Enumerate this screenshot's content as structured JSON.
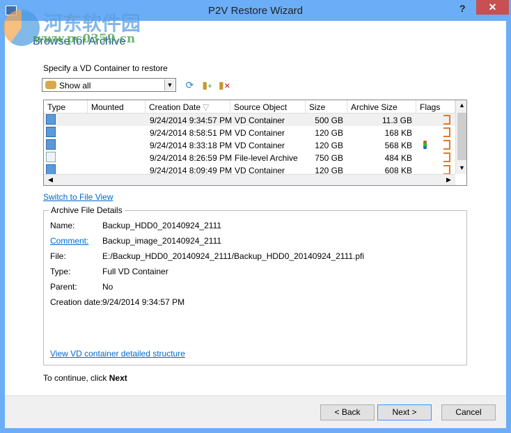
{
  "window": {
    "title": "P2V Restore Wizard",
    "help": "?",
    "close": "✕"
  },
  "watermark": {
    "cn": "河东软件园",
    "url": "www.pc0359.cn"
  },
  "heading": "Browse for Archive",
  "specify_label": "Specify a VD Container to restore",
  "filter": {
    "value": "Show all"
  },
  "toolbar": [
    "refresh-icon",
    "add-archive-icon",
    "remove-archive-icon"
  ],
  "table": {
    "columns": [
      "Type",
      "Mounted",
      "Creation Date",
      "Source Object",
      "Size",
      "Archive Size",
      "Flags"
    ],
    "sort_indicator": "▽",
    "rows": [
      {
        "type": "vd",
        "mounted": "",
        "date": "9/24/2014 9:34:57 PM",
        "source": "VD Container",
        "size": "500 GB",
        "archive_size": "11.3 GB",
        "selected": true
      },
      {
        "type": "vd",
        "mounted": "",
        "date": "9/24/2014 8:58:51 PM",
        "source": "VD Container",
        "size": "120 GB",
        "archive_size": "168 KB"
      },
      {
        "type": "vd",
        "mounted": "",
        "date": "9/24/2014 8:33:18 PM",
        "source": "VD Container",
        "size": "120 GB",
        "archive_size": "568 KB",
        "archive_flag": true
      },
      {
        "type": "file",
        "mounted": "",
        "date": "9/24/2014 8:26:59 PM",
        "source": "File-level Archive",
        "size": "750 GB",
        "archive_size": "484 KB"
      },
      {
        "type": "vd",
        "mounted": "",
        "date": "9/24/2014 8:09:49 PM",
        "source": "VD Container",
        "size": "120 GB",
        "archive_size": "608 KB"
      }
    ]
  },
  "switch_link": "Switch to File View",
  "details": {
    "title": "Archive File Details",
    "name_label": "Name:",
    "name": "Backup_HDD0_20140924_2111",
    "comment_label": "Comment:",
    "comment": "Backup_image_20140924_2111",
    "file_label": "File:",
    "file": "E:/Backup_HDD0_20140924_2111/Backup_HDD0_20140924_2111.pfi",
    "type_label": "Type:",
    "type": "Full VD Container",
    "parent_label": "Parent:",
    "parent": "No",
    "date_label": "Creation date:",
    "date": "9/24/2014 9:34:57 PM",
    "structure_link": "View VD container detailed structure"
  },
  "continue": {
    "text": "To continue, click",
    "bold": "Next"
  },
  "buttons": {
    "back": "< Back",
    "next": "Next >",
    "cancel": "Cancel"
  }
}
